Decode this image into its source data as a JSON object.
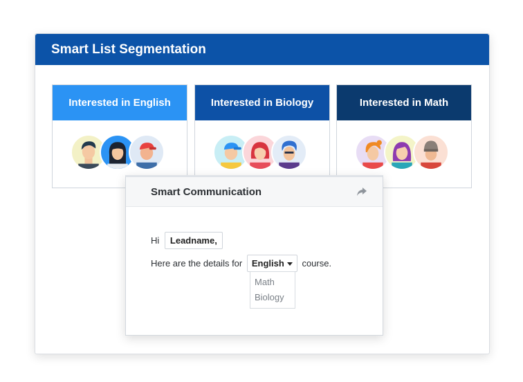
{
  "panel": {
    "title": "Smart List Segmentation"
  },
  "segments": [
    {
      "label": "Interested in English",
      "color": "#2b93f4"
    },
    {
      "label": "Interested in Biology",
      "color": "#0d51a6"
    },
    {
      "label": "Interested in Math",
      "color": "#0b3a6e"
    }
  ],
  "communication": {
    "title": "Smart Communication",
    "greeting": "Hi",
    "lead_token": "Leadname,",
    "details_prefix": "Here are the details for",
    "selected_course": "English",
    "details_suffix": "course.",
    "options": [
      "Math",
      "Biology"
    ]
  }
}
